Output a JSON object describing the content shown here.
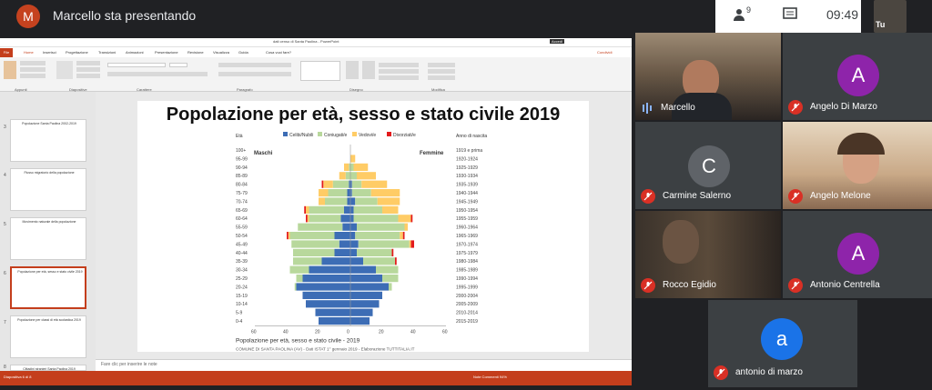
{
  "meet": {
    "presenter_initial": "M",
    "presenting_title": "Marcello sta presentando",
    "time": "09:49",
    "people_count": "9",
    "self_label": "Tu"
  },
  "colors": {
    "accent": "#c43e1c",
    "mic_off": "#d93025",
    "avatar_a": "#8e24aa",
    "avatar_c": "#5f6368",
    "avatar_a2": "#1a73e8"
  },
  "participants": [
    {
      "name": "Marcello",
      "mic": "on",
      "type": "video"
    },
    {
      "name": "Angelo Di Marzo",
      "initial": "A",
      "mic": "off",
      "type": "avatar"
    },
    {
      "name": "Carmine Salerno",
      "initial": "C",
      "mic": "off",
      "type": "avatar"
    },
    {
      "name": "Angelo Melone",
      "mic": "off",
      "type": "video"
    },
    {
      "name": "Rocco Egidio",
      "mic": "off",
      "type": "video"
    },
    {
      "name": "Antonio Centrella",
      "initial": "A",
      "mic": "off",
      "type": "avatar"
    },
    {
      "name": "antonio di marzo",
      "initial": "a",
      "mic": "off",
      "type": "avatar"
    }
  ],
  "ppt": {
    "doc_title": "dati censo di Santa Paolina - PowerPoint",
    "tabs": [
      "File",
      "Home",
      "Inserisci",
      "Progettazione",
      "Transizioni",
      "Animazioni",
      "Presentazione",
      "Revisione",
      "Visualizza",
      "Guida",
      "Cosa vuoi fare?"
    ],
    "groups": [
      "Appunti",
      "Diapositive",
      "Carattere",
      "Paragrafo",
      "Disegno",
      "Modifica"
    ],
    "thumb_titles": [
      "Popolazione Santa Paolina 2002-2019",
      "Flusso migratorio della popolazione",
      "Movimento naturale della popolazione",
      "Popolazione per età, sesso e stato civile 2019",
      "Popolazione per classi di età scolastica 2019",
      "Cittadini stranieri Santa Paolina 2019"
    ],
    "thumb_numbers": [
      "3",
      "4",
      "5",
      "6",
      "7",
      "8"
    ],
    "notes_placeholder": "Fare clic per inserire le note",
    "status_left": "Diapositiva 6 di 8",
    "status_right": "Note  Commenti  94%",
    "share_label": "Condividi",
    "signin_label": "Accedi"
  },
  "chart_data": {
    "type": "bar",
    "title": "Popolazione per età, sesso e stato civile 2019",
    "legend": [
      "Celibi/Nubili",
      "Coniugati/e",
      "Vedovi/e",
      "Divorziati/e"
    ],
    "legend_colors": [
      "#3d6db5",
      "#b8d89c",
      "#ffcc66",
      "#e31a1c"
    ],
    "age_label": "Età",
    "birth_label": "Anno di nascita",
    "male_label": "Maschi",
    "female_label": "Femmine",
    "age_classes": [
      "100+",
      "95-99",
      "90-94",
      "85-89",
      "80-84",
      "75-79",
      "70-74",
      "65-69",
      "60-64",
      "55-59",
      "50-54",
      "45-49",
      "40-44",
      "35-39",
      "30-34",
      "25-29",
      "20-24",
      "15-19",
      "10-14",
      "5-9",
      "0-4"
    ],
    "birth_years": [
      "1919 e prima",
      "1920-1924",
      "1925-1929",
      "1930-1934",
      "1935-1939",
      "1940-1944",
      "1945-1949",
      "1950-1954",
      "1955-1959",
      "1960-1964",
      "1965-1969",
      "1970-1974",
      "1975-1979",
      "1980-1984",
      "1985-1989",
      "1990-1994",
      "1995-1999",
      "2000-2004",
      "2005-2009",
      "2010-2014",
      "2015-2019"
    ],
    "males": {
      "celibi": [
        0,
        0,
        0,
        0,
        1,
        2,
        2,
        4,
        6,
        5,
        10,
        7,
        10,
        18,
        26,
        30,
        34,
        30,
        28,
        22,
        20
      ],
      "coniugati": [
        0,
        0,
        1,
        3,
        10,
        12,
        14,
        22,
        20,
        28,
        28,
        30,
        26,
        18,
        12,
        4,
        1,
        0,
        0,
        0,
        0
      ],
      "vedovi": [
        0,
        0,
        3,
        4,
        6,
        6,
        4,
        2,
        1,
        0,
        1,
        0,
        0,
        0,
        0,
        0,
        0,
        0,
        0,
        0,
        0
      ],
      "divorziati": [
        0,
        0,
        0,
        0,
        1,
        0,
        0,
        1,
        1,
        0,
        1,
        0,
        0,
        0,
        0,
        0,
        0,
        0,
        0,
        0,
        0
      ]
    },
    "females": {
      "nubili": [
        0,
        0,
        0,
        0,
        1,
        1,
        3,
        2,
        2,
        4,
        3,
        5,
        4,
        8,
        16,
        20,
        24,
        20,
        18,
        14,
        12
      ],
      "coniugate": [
        0,
        0,
        2,
        4,
        6,
        12,
        14,
        18,
        28,
        30,
        28,
        32,
        22,
        20,
        14,
        10,
        2,
        0,
        0,
        0,
        0
      ],
      "vedove": [
        0,
        3,
        9,
        12,
        16,
        18,
        14,
        10,
        8,
        2,
        2,
        1,
        0,
        0,
        0,
        0,
        0,
        0,
        0,
        0,
        0
      ],
      "divorziate": [
        0,
        0,
        0,
        0,
        0,
        0,
        0,
        0,
        1,
        0,
        1,
        2,
        1,
        1,
        0,
        0,
        0,
        0,
        0,
        0,
        0
      ]
    },
    "x_ticks": [
      "60",
      "40",
      "20",
      "0",
      "20",
      "40",
      "60"
    ],
    "xlim": [
      -60,
      60
    ],
    "footer_title": "Popolazione per età, sesso e stato civile - 2019",
    "footer_source": "COMUNE DI SANTA PAOLINA (AV) - Dati ISTAT 1° gennaio 2019 - Elaborazione TUTTITALIA.IT"
  }
}
